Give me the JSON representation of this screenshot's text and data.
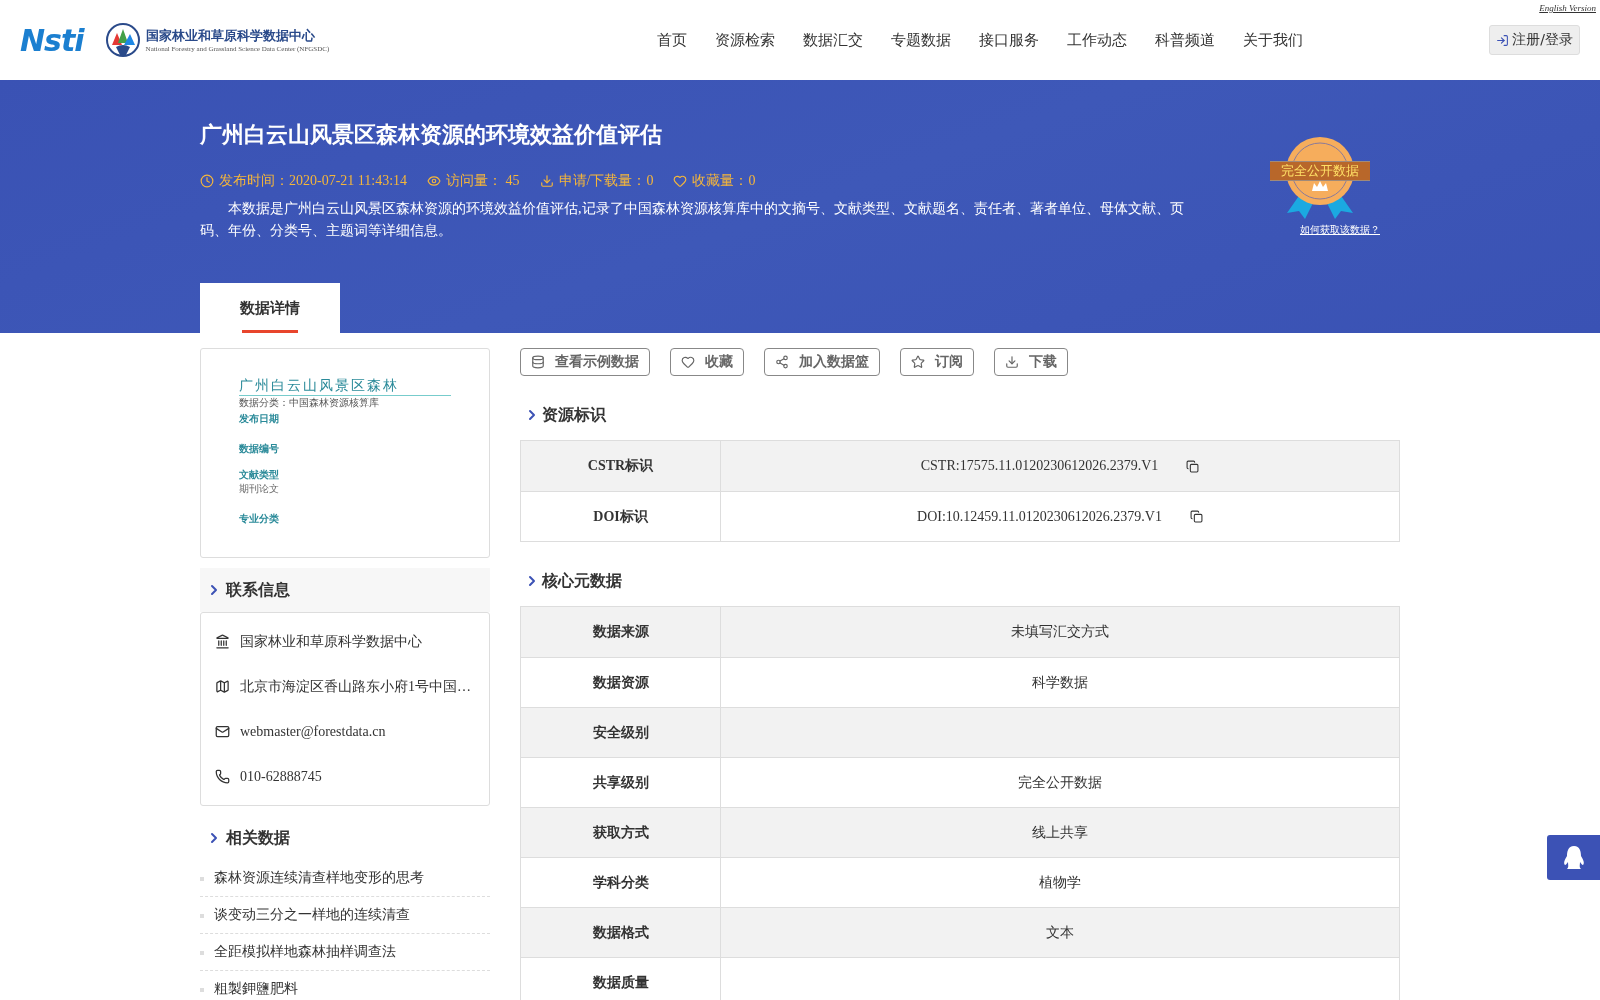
{
  "header": {
    "logo_text": "Nsti",
    "org_name": "国家林业和草原科学数据中心",
    "org_name_en": "National Forestry and Grassland Science Data Center (NFGSDC)",
    "english_link": "English Version",
    "login": "注册/登录",
    "nav": [
      {
        "label": "首页",
        "selected": false
      },
      {
        "label": "资源检索",
        "selected": false
      },
      {
        "label": "数据汇交",
        "selected": false
      },
      {
        "label": "专题数据",
        "selected": false
      },
      {
        "label": "接口服务",
        "selected": false
      },
      {
        "label": "工作动态",
        "selected": false
      },
      {
        "label": "科普频道",
        "selected": false
      },
      {
        "label": "关于我们",
        "selected": false
      }
    ]
  },
  "banner": {
    "title": "广州白云山风景区森林资源的环境效益价值评估",
    "meta": [
      {
        "kind": "clock",
        "text": "发布时间：2020-07-21 11:43:14"
      },
      {
        "kind": "eye",
        "text": "访问量： 45"
      },
      {
        "kind": "download",
        "text": "申请/下载量：0"
      },
      {
        "kind": "heart",
        "text": "收藏量：0"
      }
    ],
    "description": "本数据是广州白云山风景区森林资源的环境效益价值评估,记录了中国森林资源核算库中的文摘号、文献类型、文献题名、责任者、著者单位、母体文献、页码、年份、分类号、主题词等详细信息。",
    "badge": "完全公开数据",
    "badge_link": "如何获取该数据？",
    "tabs": [
      {
        "label": "数据详情",
        "selected": true
      }
    ]
  },
  "cover": {
    "title": "广州白云山风景区森林",
    "subtitle": "数据分类：中国森林资源核算库",
    "fields": [
      {
        "label": "发布日期"
      },
      {
        "label": "数据编号"
      },
      {
        "label": "文献类型",
        "value": "期刊论文"
      },
      {
        "label": "专业分类"
      }
    ]
  },
  "contact": {
    "heading": "联系信息",
    "items": [
      {
        "kind": "bank",
        "text": "国家林业和草原科学数据中心"
      },
      {
        "kind": "map",
        "text": "北京市海淀区香山路东小府1号中国…"
      },
      {
        "kind": "mail",
        "text": "webmaster@forestdata.cn"
      },
      {
        "kind": "phone",
        "text": "010-62888745"
      }
    ]
  },
  "related": {
    "heading": "相关数据",
    "items": [
      "森林资源连续清查样地变形的思考",
      "谈变动三分之一样地的连续清查",
      "全距模拟样地森林抽样调查法",
      "粗製鉀鹽肥料"
    ]
  },
  "actions": [
    {
      "kind": "database",
      "label": "查看示例数据"
    },
    {
      "kind": "heart",
      "label": "收藏"
    },
    {
      "kind": "share",
      "label": "加入数据篮"
    },
    {
      "kind": "star",
      "label": "订阅"
    },
    {
      "kind": "download",
      "label": "下载"
    }
  ],
  "identifiers": {
    "heading": "资源标识",
    "rows": [
      {
        "label": "CSTR标识",
        "value": "CSTR:17575.11.0120230612026.2379.V1"
      },
      {
        "label": "DOI标识",
        "value": "DOI:10.12459.11.0120230612026.2379.V1"
      }
    ]
  },
  "core": {
    "heading": "核心元数据",
    "rows": [
      {
        "label": "数据来源",
        "value": "未填写汇交方式"
      },
      {
        "label": "数据资源",
        "value": "科学数据"
      },
      {
        "label": "安全级别"
      },
      {
        "label": "共享级别",
        "value": "完全公开数据"
      },
      {
        "label": "获取方式",
        "value": "线上共享"
      },
      {
        "label": "学科分类",
        "value": "植物学"
      },
      {
        "label": "数据格式",
        "value": "文本"
      },
      {
        "label": "数据质量"
      }
    ]
  }
}
